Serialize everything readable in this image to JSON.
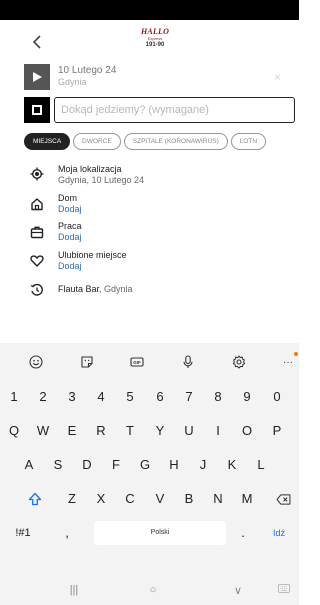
{
  "header": {
    "back_icon": "chevron-left-icon",
    "logo_line1": "HALLO",
    "logo_line2": "Express",
    "logo_line3": "191-90"
  },
  "route": {
    "from_title": "10 Lutego 24",
    "from_subtitle": "Gdynia",
    "from_clear": "×",
    "to_placeholder": "Dokąd jedziemy? (wymagane)",
    "to_value": ""
  },
  "chips": [
    {
      "label": "MIEJSCA",
      "active": true
    },
    {
      "label": "DWORCE",
      "active": false
    },
    {
      "label": "SZPITALE (KORONAWIRUS)",
      "active": false
    },
    {
      "label": "LOTN",
      "active": false
    }
  ],
  "places": [
    {
      "title": "Moja lokalizacja",
      "subtitle": "Gdynia, 10 Lutego 24",
      "icon": "location-target-icon",
      "subtitle_style": "grey"
    },
    {
      "title": "Dom",
      "subtitle": "Dodaj",
      "icon": "home-icon",
      "subtitle_style": "blue"
    },
    {
      "title": "Praca",
      "subtitle": "Dodaj",
      "icon": "briefcase-icon",
      "subtitle_style": "blue"
    },
    {
      "title": "Ulubione miejsce",
      "subtitle": "Dodaj",
      "icon": "heart-icon",
      "subtitle_style": "blue"
    },
    {
      "title": "Flauta Bar",
      "title_suffix": ", Gdynia",
      "subtitle": "",
      "icon": "history-icon",
      "subtitle_style": "grey"
    }
  ],
  "keyboard": {
    "toolbar": [
      "emoji-icon",
      "sticker-icon",
      "gif-icon",
      "microphone-icon",
      "settings-icon",
      "more-icon"
    ],
    "gif_label": "GIF",
    "more_label": "···",
    "number_row": [
      "1",
      "2",
      "3",
      "4",
      "5",
      "6",
      "7",
      "8",
      "9",
      "0"
    ],
    "row1": [
      "Q",
      "W",
      "E",
      "R",
      "T",
      "Y",
      "U",
      "I",
      "O",
      "P"
    ],
    "row2": [
      "A",
      "S",
      "D",
      "F",
      "G",
      "H",
      "J",
      "K",
      "L"
    ],
    "row3": [
      "Z",
      "X",
      "C",
      "V",
      "B",
      "N",
      "M"
    ],
    "symbols_label": "!#1",
    "comma_label": ",",
    "space_label": "Polski",
    "period_label": ".",
    "action_label": "Idź",
    "shift_icon": "shift-icon",
    "backspace_icon": "backspace-icon",
    "accent_color": "#1a73e8"
  },
  "navbar": {
    "recents": "|||",
    "home": "○",
    "back": "∨",
    "keyboard": "keyboard-icon"
  }
}
